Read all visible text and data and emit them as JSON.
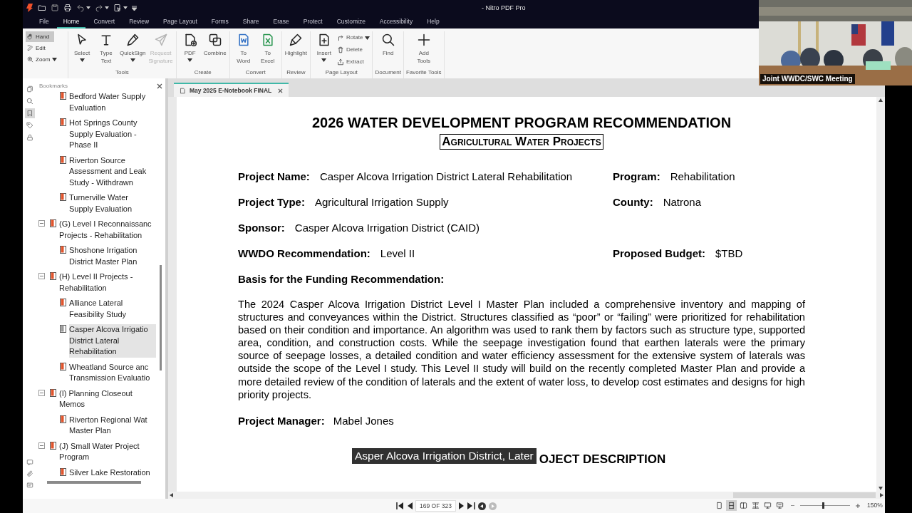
{
  "window": {
    "title": "- Nitro PDF Pro"
  },
  "menu_tabs": [
    {
      "label": "File",
      "selected": false
    },
    {
      "label": "Home",
      "selected": true
    },
    {
      "label": "Convert",
      "selected": false
    },
    {
      "label": "Review",
      "selected": false
    },
    {
      "label": "Page Layout",
      "selected": false
    },
    {
      "label": "Forms",
      "selected": false
    },
    {
      "label": "Share",
      "selected": false
    },
    {
      "label": "Erase",
      "selected": false
    },
    {
      "label": "Protect",
      "selected": false
    },
    {
      "label": "Customize",
      "selected": false
    },
    {
      "label": "Accessibility",
      "selected": false
    },
    {
      "label": "Help",
      "selected": false
    }
  ],
  "mode_tools": [
    {
      "label": "Hand",
      "kind": "hand",
      "selected": true,
      "dropdown": false
    },
    {
      "label": "Edit",
      "kind": "edit",
      "selected": false,
      "dropdown": false
    },
    {
      "label": "Zoom",
      "kind": "zoom",
      "selected": false,
      "dropdown": true
    }
  ],
  "ribbon_groups": [
    {
      "label": "Tools",
      "buttons": [
        {
          "label": "Select",
          "kind": "cursor",
          "dropdown": true,
          "disabled": false
        },
        {
          "label": "Type\nText",
          "kind": "text",
          "dropdown": false,
          "disabled": false
        },
        {
          "label": "QuickSign",
          "kind": "pen",
          "dropdown": true,
          "disabled": false
        },
        {
          "label": "Request\nSignature",
          "kind": "send",
          "dropdown": false,
          "disabled": true
        }
      ]
    },
    {
      "label": "Create",
      "buttons": [
        {
          "label": "PDF",
          "kind": "pdf",
          "dropdown": true,
          "disabled": false
        },
        {
          "label": "Combine",
          "kind": "combine",
          "dropdown": false,
          "disabled": false
        }
      ]
    },
    {
      "label": "Convert",
      "buttons": [
        {
          "label": "To\nWord",
          "kind": "word",
          "dropdown": false,
          "disabled": false
        },
        {
          "label": "To\nExcel",
          "kind": "excel",
          "dropdown": false,
          "disabled": false
        }
      ]
    },
    {
      "label": "Review",
      "buttons": [
        {
          "label": "Highlight",
          "kind": "highlight",
          "dropdown": false,
          "disabled": false
        }
      ]
    },
    {
      "label": "Page Layout",
      "buttons": [
        {
          "label": "Insert",
          "kind": "insert",
          "dropdown": true,
          "disabled": false
        }
      ],
      "small_buttons": [
        {
          "label": "Rotate",
          "kind": "rotate",
          "dropdown": true
        },
        {
          "label": "Delete",
          "kind": "delete",
          "dropdown": false
        },
        {
          "label": "Extract",
          "kind": "extract",
          "dropdown": false
        }
      ]
    },
    {
      "label": "Document",
      "buttons": [
        {
          "label": "Find",
          "kind": "find",
          "dropdown": false,
          "disabled": false
        }
      ]
    },
    {
      "label": "Favorite Tools",
      "buttons": [
        {
          "label": "Add\nTools",
          "kind": "add",
          "dropdown": false,
          "disabled": false
        }
      ]
    }
  ],
  "video": {
    "caption": "Joint WWDC/SWC Meeting"
  },
  "side_tabs": [
    {
      "kind": "pages",
      "selected": false
    },
    {
      "kind": "search",
      "selected": false
    },
    {
      "kind": "bookmark",
      "selected": true
    },
    {
      "kind": "tag",
      "selected": false
    },
    {
      "kind": "lock",
      "selected": false
    }
  ],
  "bookmarks_panel": {
    "title": "Bookmarks",
    "items": [
      {
        "label": "Bedford Water Supply\nEvaluation",
        "selected": false
      },
      {
        "label": "Hot Springs County\nSupply Evaluation -\nPhase II",
        "selected": false
      },
      {
        "label": "Riverton Source\nAssessment and Leak\nStudy - Withdrawn",
        "selected": false
      },
      {
        "label": "Turnerville Water\nSupply Evaluation",
        "selected": false
      },
      {
        "label": "(G) Level I Reconnaissanc\nProjects - Rehabilitation",
        "selected": false,
        "expanded": true,
        "children": [
          {
            "label": "Shoshone Irrigation\nDistrict Master Plan",
            "selected": false
          }
        ]
      },
      {
        "label": "(H) Level II Projects -\nRehabilitation",
        "selected": false,
        "expanded": true,
        "children": [
          {
            "label": "Alliance Lateral\nFeasibility Study",
            "selected": false
          },
          {
            "label": "Casper Alcova Irrigatio\nDistrict Lateral\nRehabilitation",
            "selected": true
          },
          {
            "label": "Wheatland Source anc\nTransmission Evaluatio",
            "selected": false
          }
        ]
      },
      {
        "label": "(I) Planning Closeout\nMemos",
        "selected": false,
        "expanded": true,
        "children": [
          {
            "label": "Riverton Regional Wat\nMaster Plan",
            "selected": false
          }
        ]
      },
      {
        "label": "(J) Small Water Project\nProgram",
        "selected": false,
        "expanded": true,
        "children": [
          {
            "label": "Silver Lake Restoration",
            "selected": false
          }
        ]
      }
    ]
  },
  "document_tab": {
    "label": "May 2025 E-Notebook FINAL",
    "selected": true
  },
  "page": {
    "title": "2026 WATER DEVELOPMENT PROGRAM RECOMMENDATION",
    "subtitle": "Agricultural Water Projects",
    "rows": [
      {
        "left": {
          "label": "Project Name:",
          "value": "Casper Alcova Irrigation District Lateral Rehabilitation"
        },
        "right": {
          "label": "Program:",
          "value": "Rehabilitation"
        }
      },
      {
        "left": {
          "label": "Project Type:",
          "value": "Agricultural Irrigation Supply"
        },
        "right": {
          "label": "County:",
          "value": "Natrona"
        }
      },
      {
        "left": {
          "label": "Sponsor:",
          "value": "Casper Alcova Irrigation District (CAID)"
        }
      },
      {
        "left": {
          "label": "WWDO Recommendation:",
          "value": "Level II"
        },
        "right": {
          "label": "Proposed Budget:",
          "value": "$TBD"
        }
      }
    ],
    "basis_heading": "Basis for the Funding Recommendation:",
    "basis_text": "The 2024 Casper Alcova Irrigation District Level I Master Plan included a comprehensive inventory and mapping of structures and conveyances within the District. Structures classified as “poor” or “failing” were prioritized for rehabilitation based on their condition and importance. An algorithm was used to rank them by factors such as structure type, supported area, condition, and construction costs. While the seepage investigation found that earthen laterals were the primary source of seepage losses, a detailed condition and water efficiency assessment for the extensive system of laterals was outside the scope of the Level I study.  This Level II study will build on the recently completed Master Plan and provide a more detailed review of the condition of laterals and the extent of water loss, to develop cost estimates and designs for high priority projects.",
    "manager": {
      "label": "Project Manager:",
      "value": "Mabel Jones"
    },
    "next_heading": "OJECT DESCRIPTION"
  },
  "caption_overlay": "Asper Alcova Irrigation District, Later",
  "status_bar": {
    "page_field": "169 OF 323",
    "view_modes": [
      {
        "kind": "single",
        "selected": false
      },
      {
        "kind": "continuous",
        "selected": true
      },
      {
        "kind": "facing",
        "selected": false
      },
      {
        "kind": "facing-continuous",
        "selected": false
      },
      {
        "kind": "fullscreen",
        "selected": false
      },
      {
        "kind": "present",
        "selected": false
      }
    ],
    "zoom": {
      "level": 0.45,
      "reading": "150%"
    }
  }
}
